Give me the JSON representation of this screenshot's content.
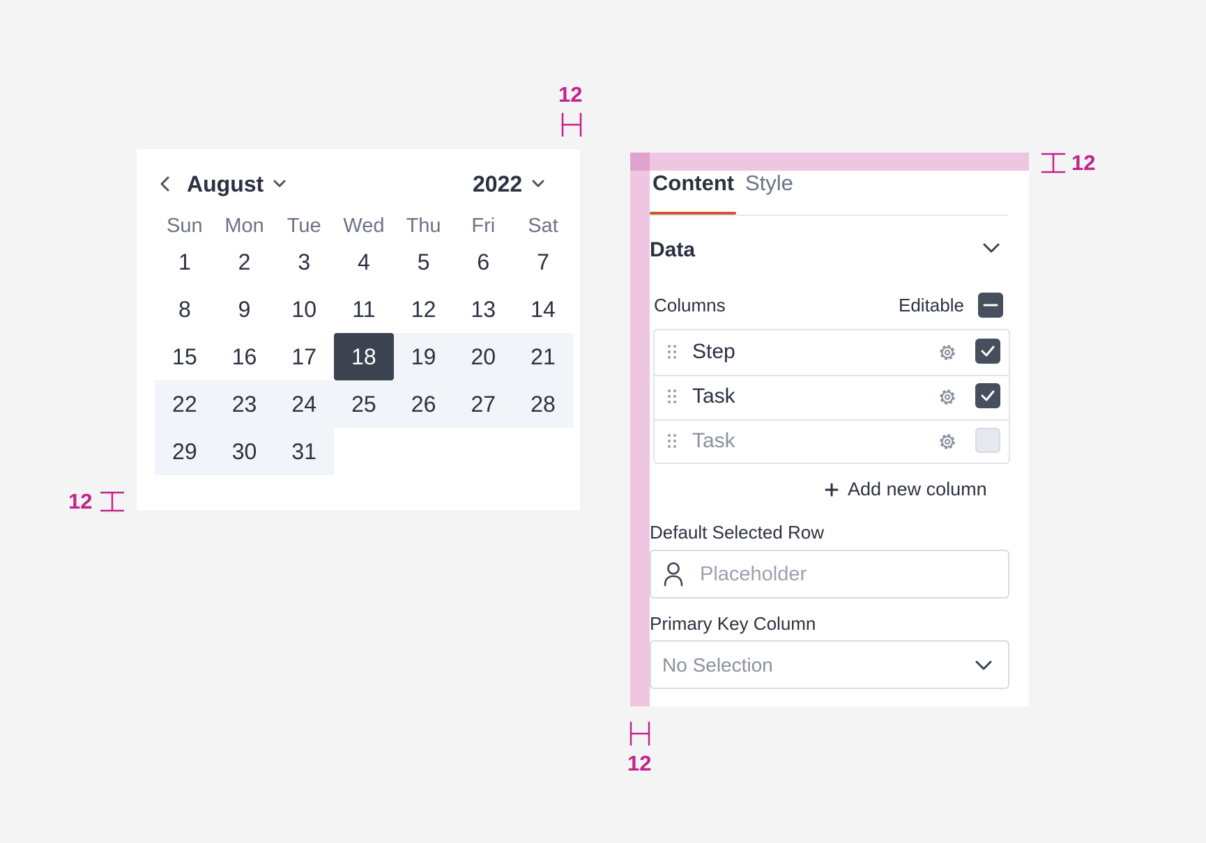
{
  "annotations": {
    "spacing_top_calendar": "12",
    "spacing_bottom_calendar": "12",
    "spacing_top_panel": "12",
    "spacing_left_panel": "12"
  },
  "calendar": {
    "month": "August",
    "year": "2022",
    "weekdays": [
      "Sun",
      "Mon",
      "Tue",
      "Wed",
      "Thu",
      "Fri",
      "Sat"
    ],
    "weeks": [
      [
        "1",
        "2",
        "3",
        "4",
        "5",
        "6",
        "7"
      ],
      [
        "8",
        "9",
        "10",
        "11",
        "12",
        "13",
        "14"
      ],
      [
        "15",
        "16",
        "17",
        "18",
        "19",
        "20",
        "21"
      ],
      [
        "22",
        "23",
        "24",
        "25",
        "26",
        "27",
        "28"
      ],
      [
        "29",
        "30",
        "31",
        "",
        "",
        "",
        ""
      ]
    ],
    "selected_day": "18"
  },
  "panel": {
    "tabs": {
      "content": "Content",
      "style": "Style"
    },
    "section_title": "Data",
    "columns_label": "Columns",
    "editable_label": "Editable",
    "columns": [
      {
        "label": "Step"
      },
      {
        "label": "Task"
      },
      {
        "label": "Task"
      }
    ],
    "add_column_label": "Add new column",
    "default_selected_row_label": "Default Selected Row",
    "default_selected_row_placeholder": "Placeholder",
    "primary_key_label": "Primary Key Column",
    "primary_key_value": "No Selection"
  },
  "colors": {
    "accent_tab": "#d0552f",
    "annotation": "#c2238a",
    "selected_day": "#3b4250"
  },
  "icons": [
    "chevron-left-icon",
    "chevron-down-icon",
    "drag-handle-icon",
    "gear-icon",
    "check-icon",
    "minus-icon",
    "plus-icon",
    "user-icon"
  ]
}
